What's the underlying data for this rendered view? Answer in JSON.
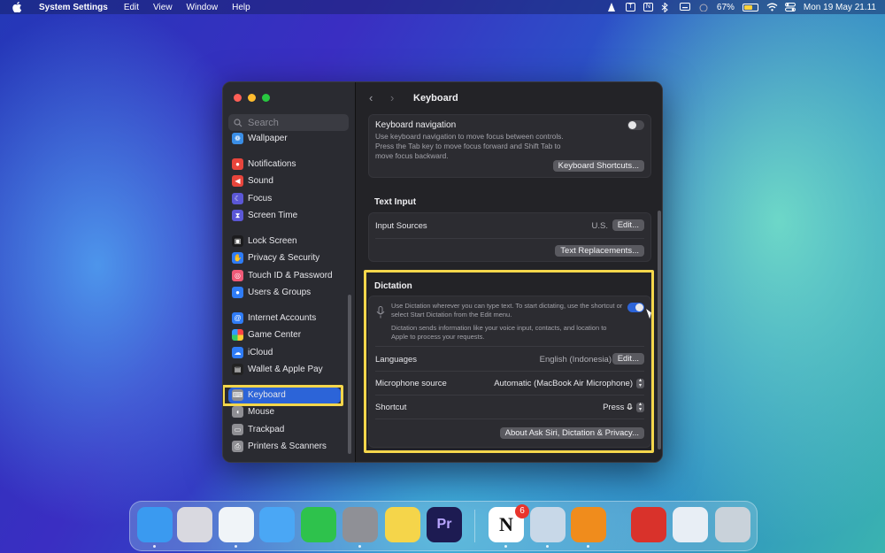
{
  "menubar": {
    "app": "System Settings",
    "items": [
      "Edit",
      "View",
      "Window",
      "Help"
    ],
    "battery_percent": "67%",
    "battery_level": 0.67,
    "datetime": "Mon 19 May  21.11",
    "status_icons": [
      "vlc-icon",
      "text-icon",
      "notion-icon",
      "bluetooth-icon",
      "keyboard-icon",
      "focus-icon",
      "wifi-icon",
      "control-center-icon"
    ]
  },
  "window": {
    "title": "Keyboard",
    "search_placeholder": "Search",
    "sidebar": [
      {
        "label": "Wallpaper",
        "icon": "wallpaper-icon",
        "color": "#3a8ee6"
      },
      {
        "label": "Notifications",
        "icon": "bell-icon",
        "color": "#e8453c"
      },
      {
        "label": "Sound",
        "icon": "speaker-icon",
        "color": "#e8453c"
      },
      {
        "label": "Focus",
        "icon": "moon-icon",
        "color": "#5b57d6"
      },
      {
        "label": "Screen Time",
        "icon": "hourglass-icon",
        "color": "#5b57d6"
      },
      {
        "label": "Lock Screen",
        "icon": "lock-icon",
        "color": "#1c1c1e"
      },
      {
        "label": "Privacy & Security",
        "icon": "hand-icon",
        "color": "#2f7cf6"
      },
      {
        "label": "Touch ID & Password",
        "icon": "fingerprint-icon",
        "color": "#f05a78"
      },
      {
        "label": "Users & Groups",
        "icon": "users-icon",
        "color": "#2f7cf6"
      },
      {
        "label": "Internet Accounts",
        "icon": "at-icon",
        "color": "#2f7cf6"
      },
      {
        "label": "Game Center",
        "icon": "game-center-icon",
        "color": "#e0e0e0"
      },
      {
        "label": "iCloud",
        "icon": "cloud-icon",
        "color": "#2f7cf6"
      },
      {
        "label": "Wallet & Apple Pay",
        "icon": "wallet-icon",
        "color": "#222222"
      },
      {
        "label": "Keyboard",
        "icon": "keyboard-icon",
        "color": "#8e8e93"
      },
      {
        "label": "Mouse",
        "icon": "mouse-icon",
        "color": "#8e8e93"
      },
      {
        "label": "Trackpad",
        "icon": "trackpad-icon",
        "color": "#8e8e93"
      },
      {
        "label": "Printers & Scanners",
        "icon": "printer-icon",
        "color": "#8e8e93"
      }
    ],
    "selected_item": "Keyboard",
    "keyboard_nav": {
      "title": "Keyboard navigation",
      "description": "Use keyboard navigation to move focus between controls. Press the Tab key to move focus forward and Shift Tab to move focus backward.",
      "enabled": false,
      "shortcuts_button": "Keyboard Shortcuts..."
    },
    "text_input": {
      "section": "Text Input",
      "input_sources_label": "Input Sources",
      "input_sources_value": "U.S.",
      "edit_button": "Edit...",
      "replacements_button": "Text Replacements..."
    },
    "dictation": {
      "section": "Dictation",
      "description": "Use Dictation wherever you can type text. To start dictating, use the shortcut or select Start Dictation from the Edit menu.",
      "privacy_note": "Dictation sends information like your voice input, contacts, and location to Apple to process your requests.",
      "enabled": true,
      "languages_label": "Languages",
      "languages_value": "English (Indonesia)",
      "languages_edit": "Edit...",
      "mic_label": "Microphone source",
      "mic_value": "Automatic (MacBook Air Microphone)",
      "shortcut_label": "Shortcut",
      "shortcut_value": "Press",
      "about_button": "About Ask Siri, Dictation & Privacy..."
    },
    "accent_color": "#2c64d8",
    "highlight_color": "#f4d64b"
  },
  "dock": {
    "apps": [
      {
        "name": "finder-icon",
        "color": "#3a9af0",
        "glyph": ""
      },
      {
        "name": "launchpad-icon",
        "color": "#d9d9e0",
        "glyph": ""
      },
      {
        "name": "safari-icon",
        "color": "#f0f4f8",
        "glyph": ""
      },
      {
        "name": "mail-icon",
        "color": "#4aa7f5",
        "glyph": ""
      },
      {
        "name": "whatsapp-icon",
        "color": "#2ec24c",
        "glyph": ""
      },
      {
        "name": "system-settings-icon",
        "color": "#8f9096",
        "glyph": ""
      },
      {
        "name": "notes-icon",
        "color": "#f5d54a",
        "glyph": ""
      },
      {
        "name": "premiere-pro-icon",
        "color": "#1d1b52",
        "glyph": "Pr"
      },
      {
        "name": "notion-icon",
        "color": "#ffffff",
        "glyph": "N"
      },
      {
        "name": "preview-icon",
        "color": "#c8d8e8",
        "glyph": ""
      },
      {
        "name": "vlc-icon",
        "color": "#f08c1c",
        "glyph": ""
      },
      {
        "name": "creative-cloud-icon",
        "color": "#d9322b",
        "glyph": ""
      },
      {
        "name": "downloads-folder-icon",
        "color": "#e8eef5",
        "glyph": ""
      },
      {
        "name": "trash-icon",
        "color": "#c9d2da",
        "glyph": ""
      }
    ],
    "notion_badge": "6"
  }
}
